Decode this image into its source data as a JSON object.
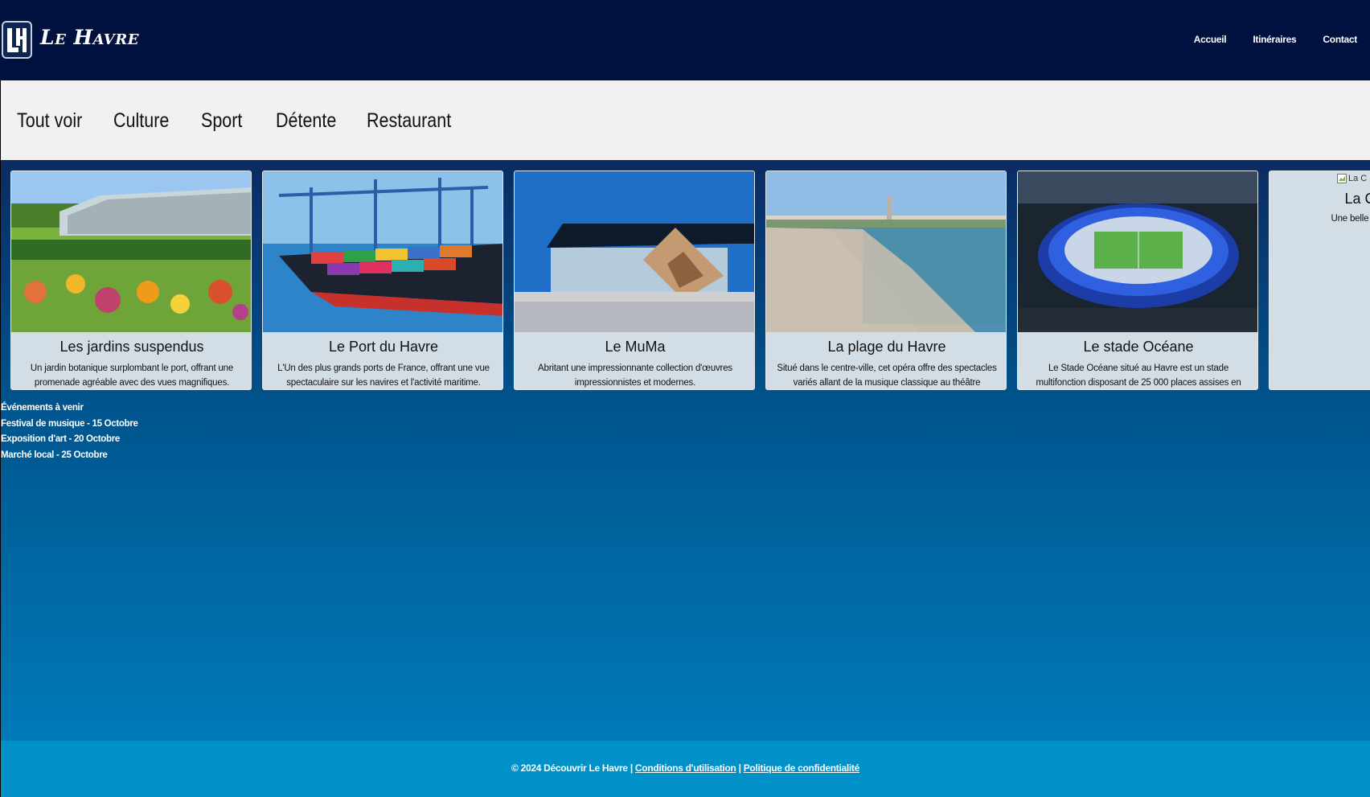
{
  "header": {
    "logo_letters": "LH",
    "site_title": "Le Havre",
    "nav": [
      "Accueil",
      "Itinéraires",
      "Contact"
    ]
  },
  "filters": [
    "Tout voir",
    "Culture",
    "Sport",
    "Détente",
    "Restaurant"
  ],
  "cards": [
    {
      "title": "Les jardins suspendus",
      "desc": "Un jardin botanique surplombant le port, offrant une promenade agréable avec des vues magnifiques."
    },
    {
      "title": "Le Port du Havre",
      "desc": "L'Un des plus grands ports de France, offrant une vue spectaculaire sur les navires et l'activité maritime."
    },
    {
      "title": "Le MuMa",
      "desc": "Abritant une impressionnante collection d'œuvres impressionnistes et modernes."
    },
    {
      "title": "La plage du Havre",
      "desc": "Situé dans le centre-ville, cet opéra offre des spectacles variés allant de la musique classique au théâtre contemporain."
    },
    {
      "title": "Le stade Océane",
      "desc": "Le Stade Océane situé au Havre est un stade multifonction disposant de 25 000 places assises en configuration football"
    },
    {
      "title": "La Cathédrale",
      "desc": "Une belle cathédrale gothique",
      "broken_alt": "La C"
    }
  ],
  "events": {
    "heading": "Événements à venir",
    "items": [
      "Festival de musique - 15 Octobre",
      "Exposition d'art - 20 Octobre",
      "Marché local - 25 Octobre"
    ]
  },
  "footer": {
    "copyright": "© 2024 Découvrir Le Havre",
    "separator": "|",
    "terms": "Conditions d'utilisation",
    "privacy": "Politique de confidentialité"
  }
}
